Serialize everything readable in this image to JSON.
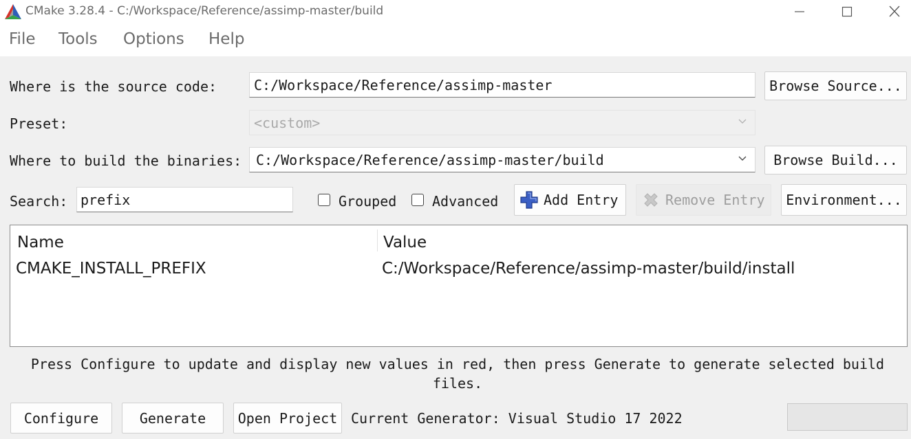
{
  "window": {
    "title": "CMake 3.28.4 - C:/Workspace/Reference/assimp-master/build",
    "controls": {
      "minimize": "—",
      "maximize": "☐",
      "close": "✕"
    }
  },
  "menu": [
    "File",
    "Tools",
    "Options",
    "Help"
  ],
  "source": {
    "label": "Where is the source code:",
    "value": "C:/Workspace/Reference/assimp-master",
    "browse_label": "Browse Source..."
  },
  "preset": {
    "label": "Preset:",
    "value": "<custom>"
  },
  "build": {
    "label": "Where to build the binaries:",
    "value": "C:/Workspace/Reference/assimp-master/build",
    "browse_label": "Browse Build..."
  },
  "search": {
    "label": "Search:",
    "value": "prefix"
  },
  "options": {
    "grouped_label": "Grouped",
    "grouped_checked": false,
    "advanced_label": "Advanced",
    "advanced_checked": false
  },
  "toolbar": {
    "add_entry": "Add Entry",
    "remove_entry": "Remove Entry",
    "environment": "Environment..."
  },
  "table": {
    "headers": [
      "Name",
      "Value"
    ],
    "rows": [
      {
        "name": "CMAKE_INSTALL_PREFIX",
        "value": "C:/Workspace/Reference/assimp-master/build/install"
      }
    ]
  },
  "hint": "Press Configure to update and display new values in red, then press Generate to generate selected build files.",
  "actions": {
    "configure": "Configure",
    "generate": "Generate",
    "open_project": "Open Project",
    "generator_status": "Current Generator: Visual Studio 17 2022"
  },
  "progress": 0,
  "colors": {
    "background": "#f0f0f0",
    "add_icon": "#3b5fc4",
    "logo_red": "#d7322b",
    "logo_blue": "#2f5fb8",
    "logo_green": "#37a34a"
  }
}
